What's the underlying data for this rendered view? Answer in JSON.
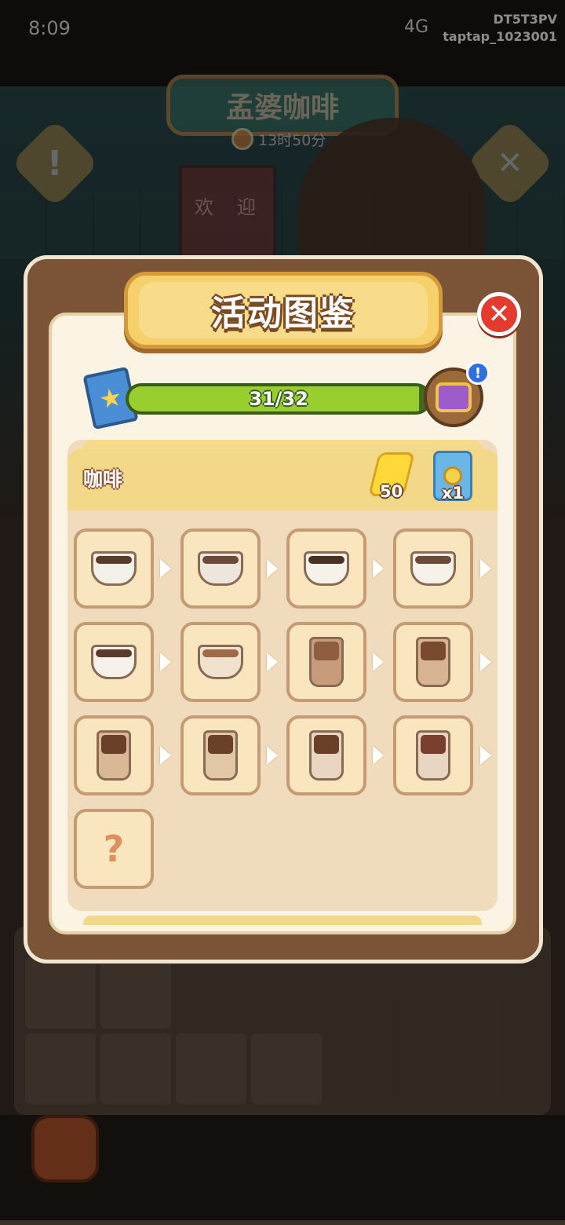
{
  "status_bar": {
    "time": "8:09",
    "signal_text": "4G",
    "watermark_line1": "DT5T3PV",
    "watermark_line2": "taptap_1023001"
  },
  "background": {
    "shop_name": "孟婆咖啡",
    "shop_timer": "13时50分",
    "door_text_left": "欢",
    "door_text_right": "迎"
  },
  "modal": {
    "title": "活动图鉴",
    "close_icon": "close-x-icon",
    "progress": {
      "current": 31,
      "total": 32,
      "label": "31/32"
    },
    "category": {
      "name": "咖啡",
      "rewards": [
        {
          "icon": "energy-bolt-icon",
          "count": "50"
        },
        {
          "icon": "key-card-icon",
          "count": "x1"
        }
      ]
    },
    "items": [
      {
        "name": "paper-cup-coffee",
        "unlocked": true
      },
      {
        "name": "mug-coffee",
        "unlocked": true
      },
      {
        "name": "cup-coffee",
        "unlocked": true
      },
      {
        "name": "cup-saucer-teabag",
        "unlocked": true
      },
      {
        "name": "coffee-cup-sugar",
        "unlocked": true
      },
      {
        "name": "latte-art-cake",
        "unlocked": true
      },
      {
        "name": "iced-glass-coffee",
        "unlocked": true
      },
      {
        "name": "cream-glass-coffee",
        "unlocked": true
      },
      {
        "name": "frappe-wafer",
        "unlocked": true
      },
      {
        "name": "frappe-chocolate",
        "unlocked": true
      },
      {
        "name": "sundae-coffee",
        "unlocked": true
      },
      {
        "name": "sundae-deluxe",
        "unlocked": true
      },
      {
        "name": "unknown",
        "unlocked": false,
        "placeholder": "?"
      }
    ]
  },
  "colors": {
    "modal_border": "#7b5437",
    "title_banner": "#f6d06a",
    "progress_fill": "#98cf2e",
    "close_button": "#e53b2f"
  }
}
